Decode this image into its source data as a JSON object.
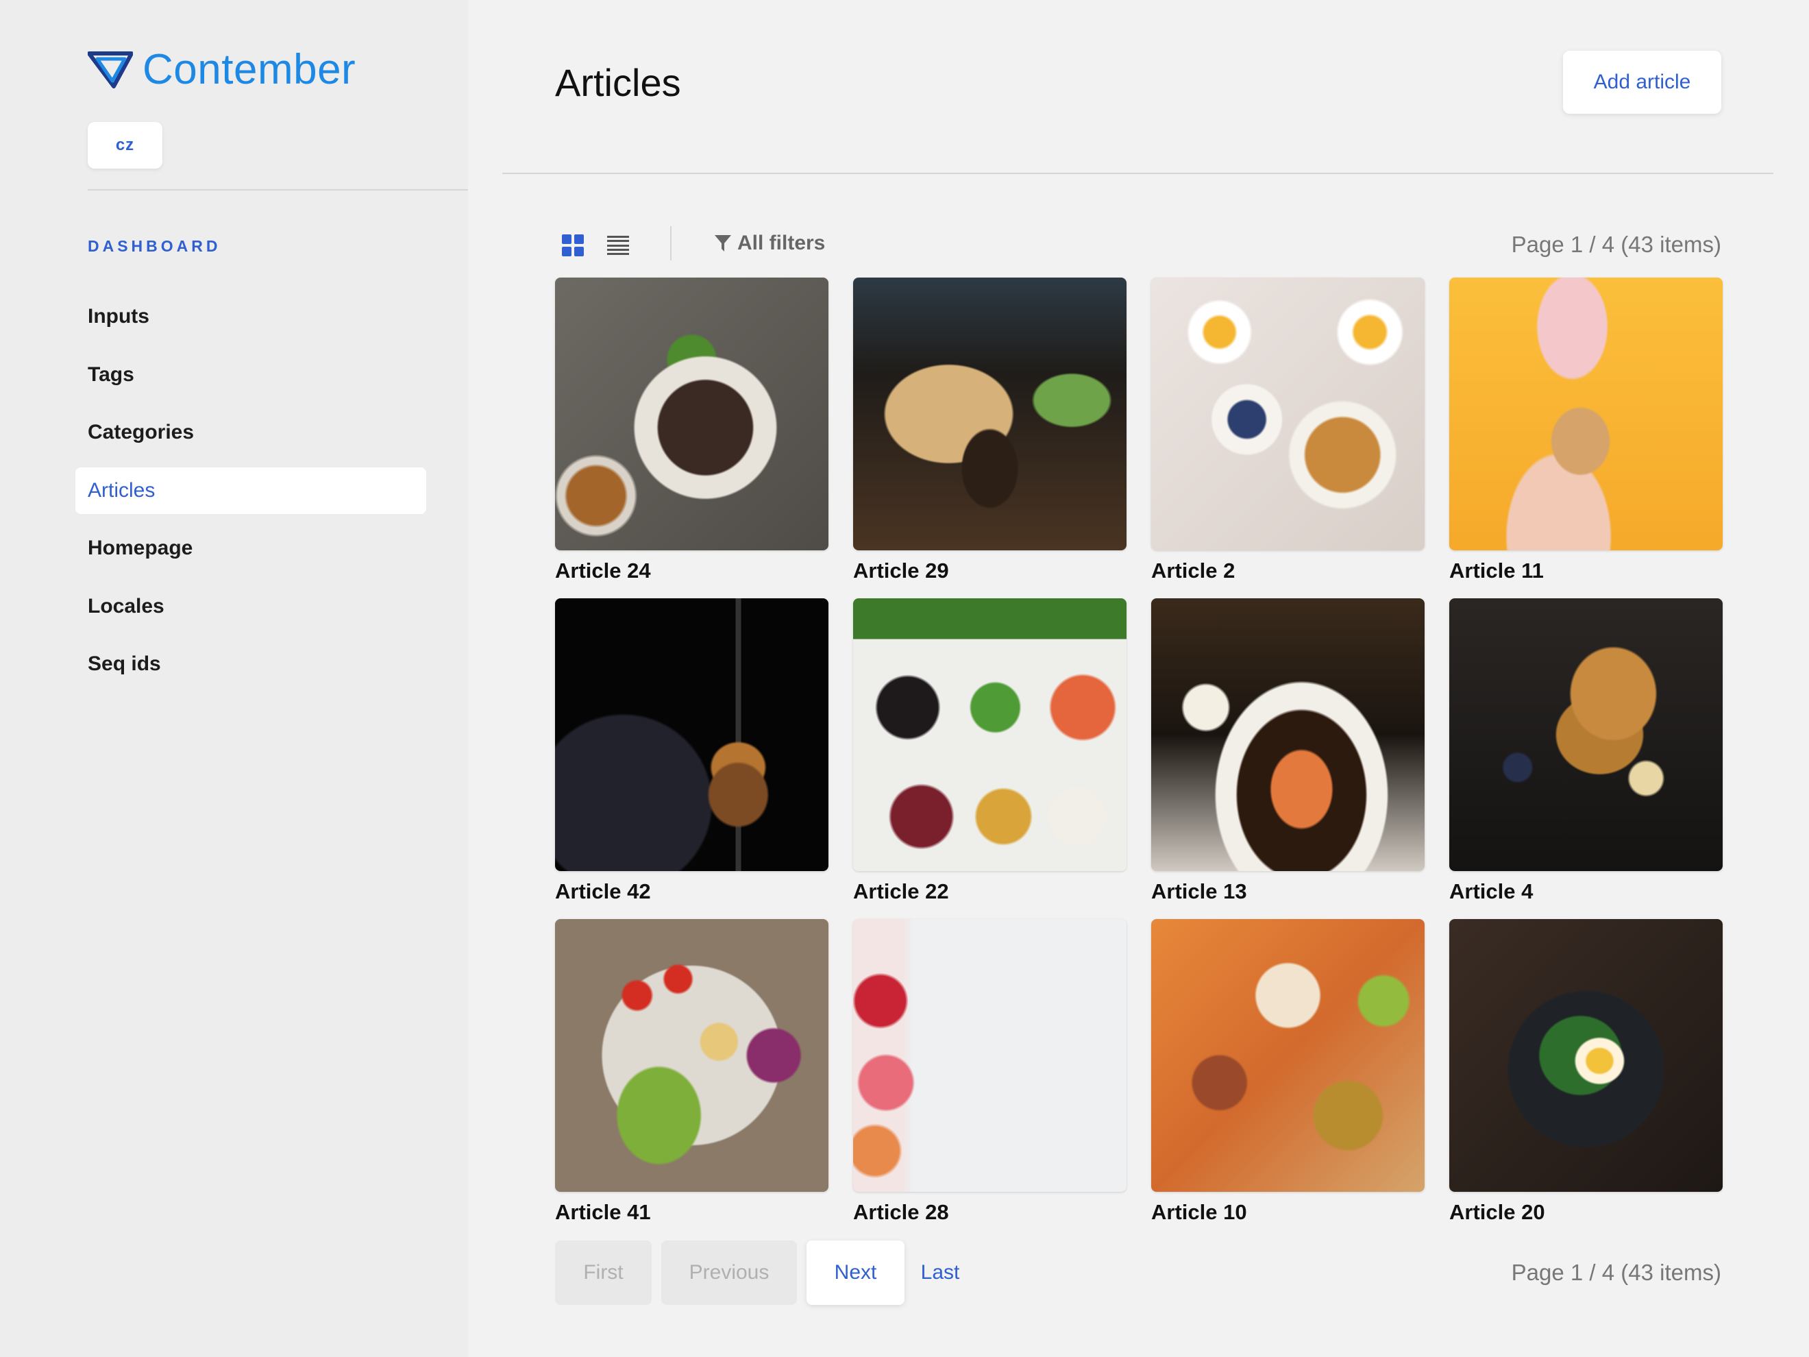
{
  "brand": {
    "name": "Contember",
    "accent": "#1e88e5",
    "link": "#2f5fd0"
  },
  "locale_button": "cz",
  "sidebar": {
    "section_title": "DASHBOARD",
    "items": [
      {
        "label": "Inputs",
        "active": false
      },
      {
        "label": "Tags",
        "active": false
      },
      {
        "label": "Categories",
        "active": false
      },
      {
        "label": "Articles",
        "active": true
      },
      {
        "label": "Homepage",
        "active": false
      },
      {
        "label": "Locales",
        "active": false
      },
      {
        "label": "Seq ids",
        "active": false
      }
    ]
  },
  "header": {
    "title": "Articles",
    "add_button": "Add article"
  },
  "toolbar": {
    "grid_view_icon": "grid-icon",
    "list_view_icon": "list-icon",
    "filter_icon": "filter-icon",
    "filters_label": "All filters",
    "page_info": "Page 1 / 4 (43 items)"
  },
  "articles": [
    {
      "title": "Article 24"
    },
    {
      "title": "Article 29"
    },
    {
      "title": "Article 2"
    },
    {
      "title": "Article 11"
    },
    {
      "title": "Article 42"
    },
    {
      "title": "Article 22"
    },
    {
      "title": "Article 13"
    },
    {
      "title": "Article 4"
    },
    {
      "title": "Article 41"
    },
    {
      "title": "Article 28"
    },
    {
      "title": "Article 10"
    },
    {
      "title": "Article 20"
    }
  ],
  "pagination": {
    "first": "First",
    "previous": "Previous",
    "next": "Next",
    "last": "Last",
    "page_info": "Page 1 / 4 (43 items)"
  }
}
